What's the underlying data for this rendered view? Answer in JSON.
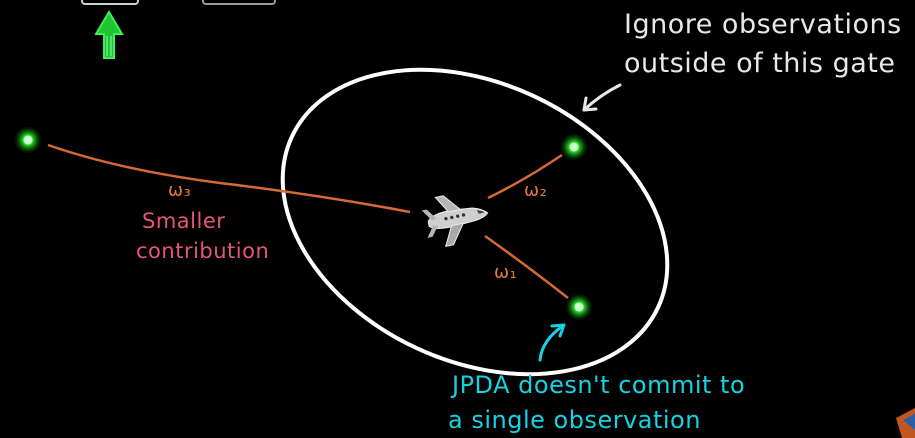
{
  "annotations": {
    "gate_note": [
      "Ignore observations",
      "outside of this gate"
    ],
    "smaller_note": [
      "Smaller",
      "contribution"
    ],
    "jpda_note": [
      "JPDA doesn't commit to",
      "a single observation"
    ]
  },
  "weights": {
    "w1": "ω₁",
    "w2": "ω₂",
    "w3": "ω₃"
  },
  "colors": {
    "background": "#000000",
    "gate": "#ffffff",
    "association_lines": "#d46a34",
    "observation": "#3bff3b",
    "gate_note": "#e8e8e8",
    "smaller_note": "#e4557a",
    "jpda_note": "#14d3e3",
    "up_arrow": "#22d43a"
  },
  "icons": {
    "target": "airplane-icon",
    "observation": "green-dot-icon",
    "up": "up-arrow-icon"
  }
}
